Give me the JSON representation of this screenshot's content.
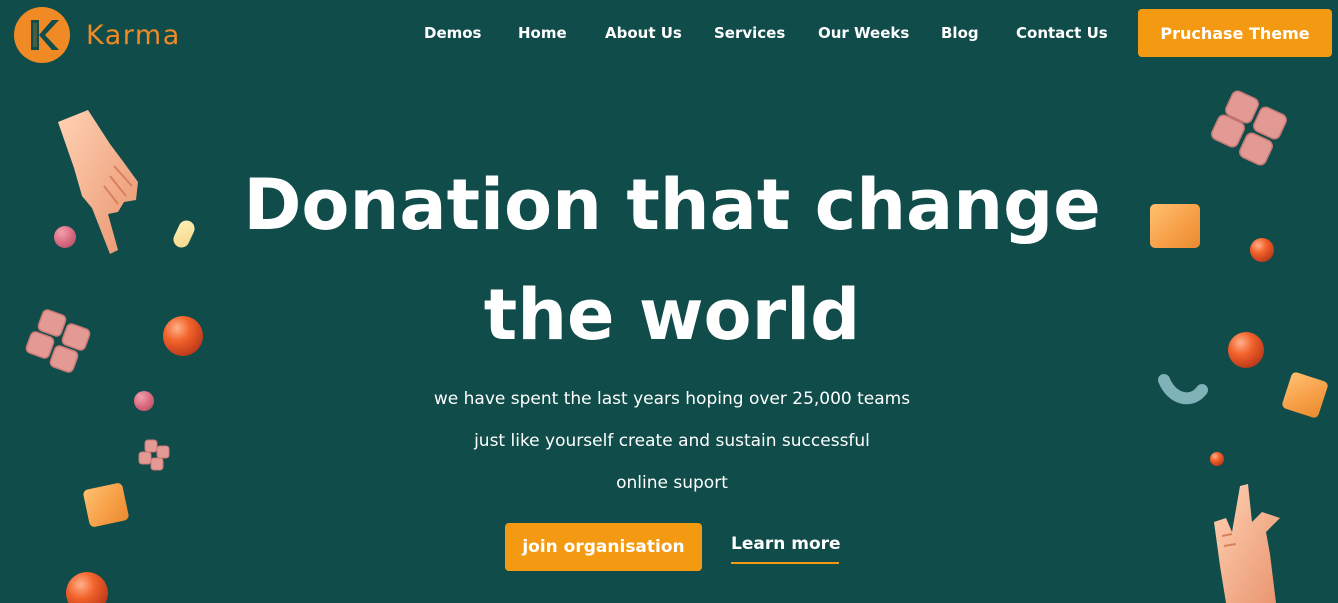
{
  "brand": {
    "name": "Karma",
    "logo_letter": "K",
    "color": "#f08a25"
  },
  "nav": {
    "items": [
      {
        "label": "Demos"
      },
      {
        "label": "Home"
      },
      {
        "label": "About Us"
      },
      {
        "label": "Services"
      },
      {
        "label": "Our Weeks"
      },
      {
        "label": "Blog"
      },
      {
        "label": "Contact Us"
      }
    ],
    "cta_label": "Pruchase Theme"
  },
  "hero": {
    "title_line1": "Donation that change",
    "title_line2": "the world",
    "sub_line1": "we have spent the last years hoping over 25,000 teams",
    "sub_line2": "just like yourself create and sustain successful",
    "sub_line3": "online suport",
    "primary_button": "join organisation",
    "secondary_link": "Learn more"
  },
  "colors": {
    "background": "#0f4c4a",
    "accent": "#f39a12",
    "text": "#ffffff"
  },
  "decorations": {
    "icons": [
      "pointing-hand-icon",
      "pointing-up-hand-icon",
      "orange-ball-icon",
      "cube-icon",
      "pink-tile-cluster-icon",
      "bead-icon",
      "pill-icon",
      "teal-arc-icon"
    ]
  }
}
